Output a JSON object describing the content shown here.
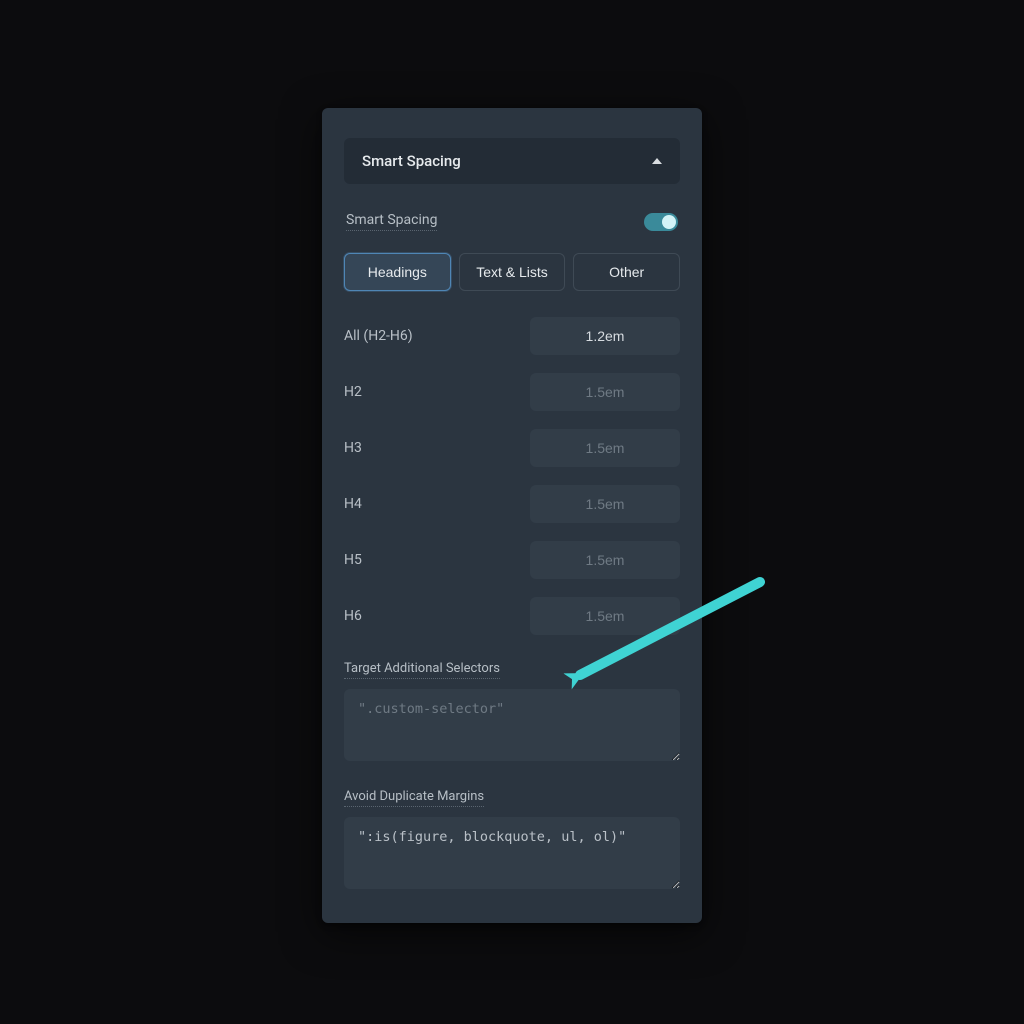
{
  "colors": {
    "accent": "#3fd3d3",
    "panel_bg": "#2b3540",
    "input_bg": "#323d48"
  },
  "section": {
    "title": "Smart Spacing"
  },
  "toggle": {
    "label": "Smart Spacing",
    "enabled": true
  },
  "tabs": [
    {
      "label": "Headings",
      "active": true
    },
    {
      "label": "Text & Lists",
      "active": false
    },
    {
      "label": "Other",
      "active": false
    }
  ],
  "headings": [
    {
      "label": "All (H2-H6)",
      "value": "1.2em",
      "placeholder": ""
    },
    {
      "label": "H2",
      "value": "",
      "placeholder": "1.5em"
    },
    {
      "label": "H3",
      "value": "",
      "placeholder": "1.5em"
    },
    {
      "label": "H4",
      "value": "",
      "placeholder": "1.5em"
    },
    {
      "label": "H5",
      "value": "",
      "placeholder": "1.5em"
    },
    {
      "label": "H6",
      "value": "",
      "placeholder": "1.5em"
    }
  ],
  "target_selectors": {
    "label": "Target Additional Selectors",
    "placeholder": "\".custom-selector\"",
    "value": ""
  },
  "avoid_margins": {
    "label": "Avoid Duplicate Margins",
    "placeholder": "",
    "value": "\":is(figure, blockquote, ul, ol)\""
  }
}
